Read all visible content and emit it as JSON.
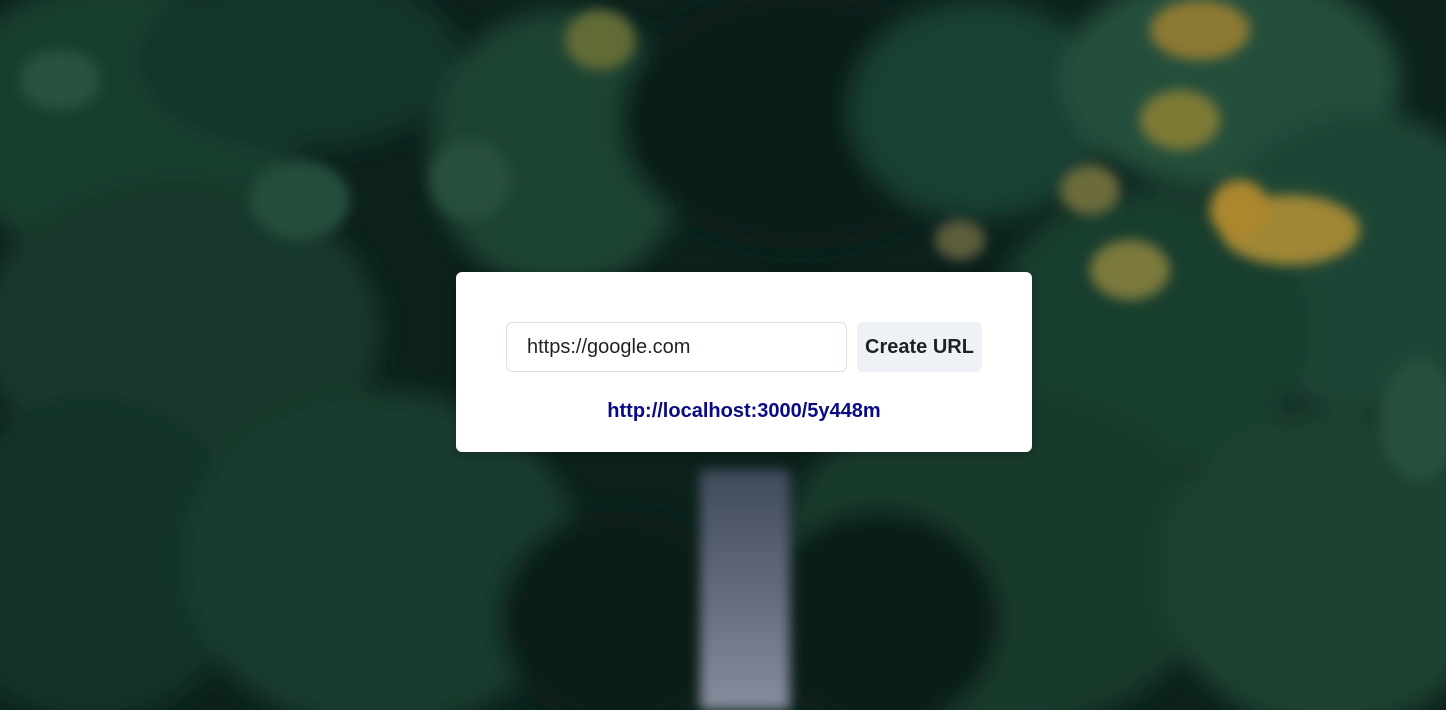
{
  "background": {
    "description_icon": "forest-bridge-background-image",
    "colors": {
      "base": "#0f2a22",
      "foliage_dark": "#12342a",
      "foliage_mid": "#1f4a3a",
      "foliage_light": "#2f5e48",
      "foliage_yellow": "#b59a3c",
      "bridge": "#8f96a8"
    }
  },
  "form": {
    "url_value": "https://google.com",
    "url_placeholder": "",
    "submit_label": "Create URL"
  },
  "result": {
    "short_url": "http://localhost:3000/5y448m"
  },
  "colors": {
    "card": "#ffffff",
    "button_bg": "#eef1f5",
    "link": "#0a0a84"
  }
}
